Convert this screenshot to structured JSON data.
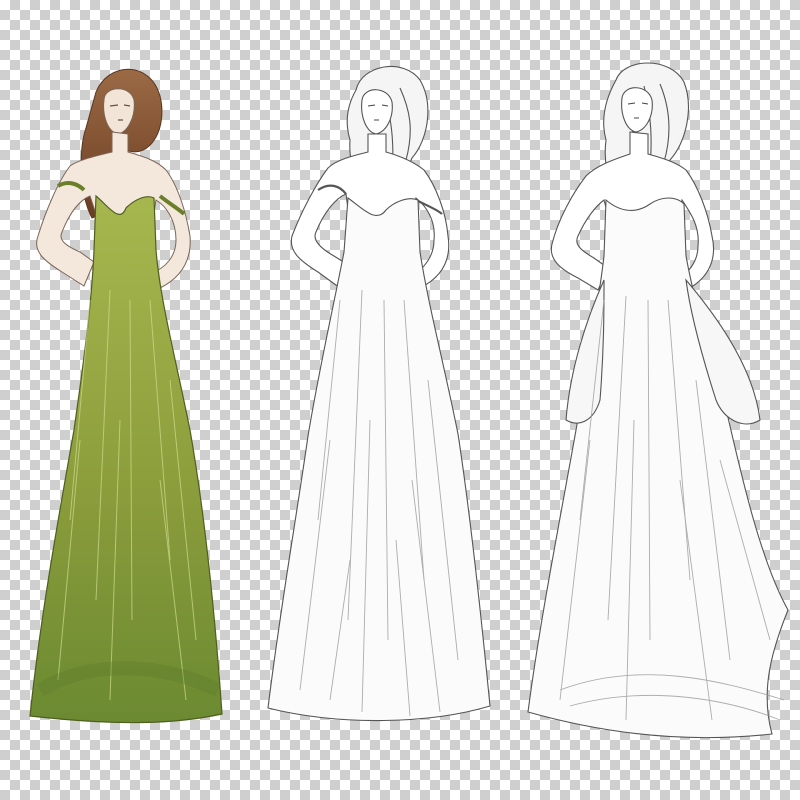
{
  "scene": {
    "background": "transparency-checkerboard",
    "figures": [
      {
        "name": "green-gown-figure",
        "style": "colored sketch",
        "dress_color": "#8a9b3d",
        "hair_color": "#7a4a2b"
      },
      {
        "name": "white-gown-figure",
        "style": "pencil sketch",
        "dress_color": "#f4f4f4"
      },
      {
        "name": "draped-gown-figure",
        "style": "pencil sketch",
        "dress_color": "#f4f4f4"
      }
    ]
  }
}
